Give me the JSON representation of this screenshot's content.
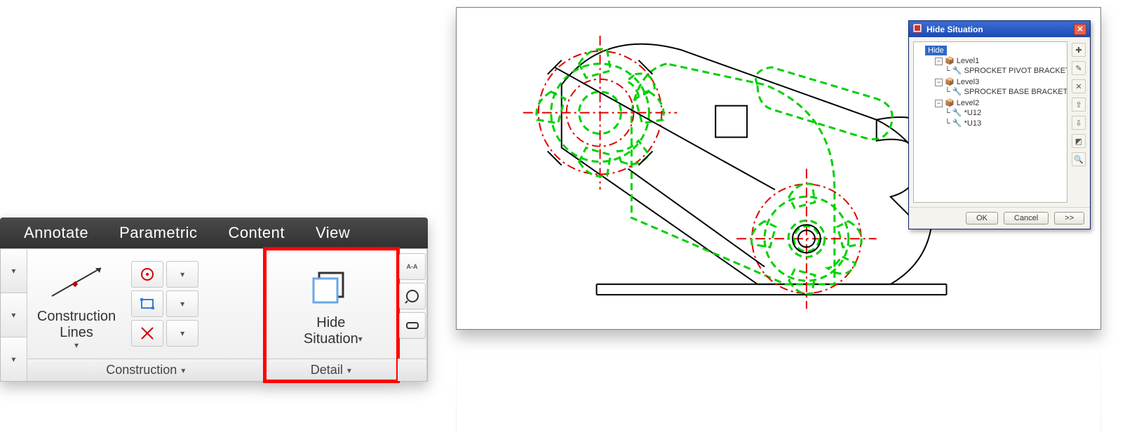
{
  "tabs": {
    "annotate": "Annotate",
    "parametric": "Parametric",
    "content": "Content",
    "view": "View"
  },
  "ribbon": {
    "construction_lines": "Construction\nLines",
    "panel_construction": "Construction",
    "hide_situation": "Hide\nSituation",
    "panel_detail": "Detail"
  },
  "icons": {
    "centerline": "centerline-icon",
    "rectangle": "rectangle-icon",
    "erase_cl": "erase-centerline-icon",
    "section_aa": "A-A",
    "detail_circle": "detail-circle-icon",
    "break": "break-icon"
  },
  "dialog": {
    "title": "Hide Situation",
    "root": "Hide",
    "levels": [
      {
        "name": "Level1",
        "children": [
          "SPROCKET PIVOT BRACKET"
        ]
      },
      {
        "name": "Level3",
        "children": [
          "SPROCKET BASE BRACKET"
        ]
      },
      {
        "name": "Level2",
        "children": [
          "*U12",
          "*U13"
        ]
      }
    ],
    "ok": "OK",
    "cancel": "Cancel",
    "more": ">>"
  }
}
